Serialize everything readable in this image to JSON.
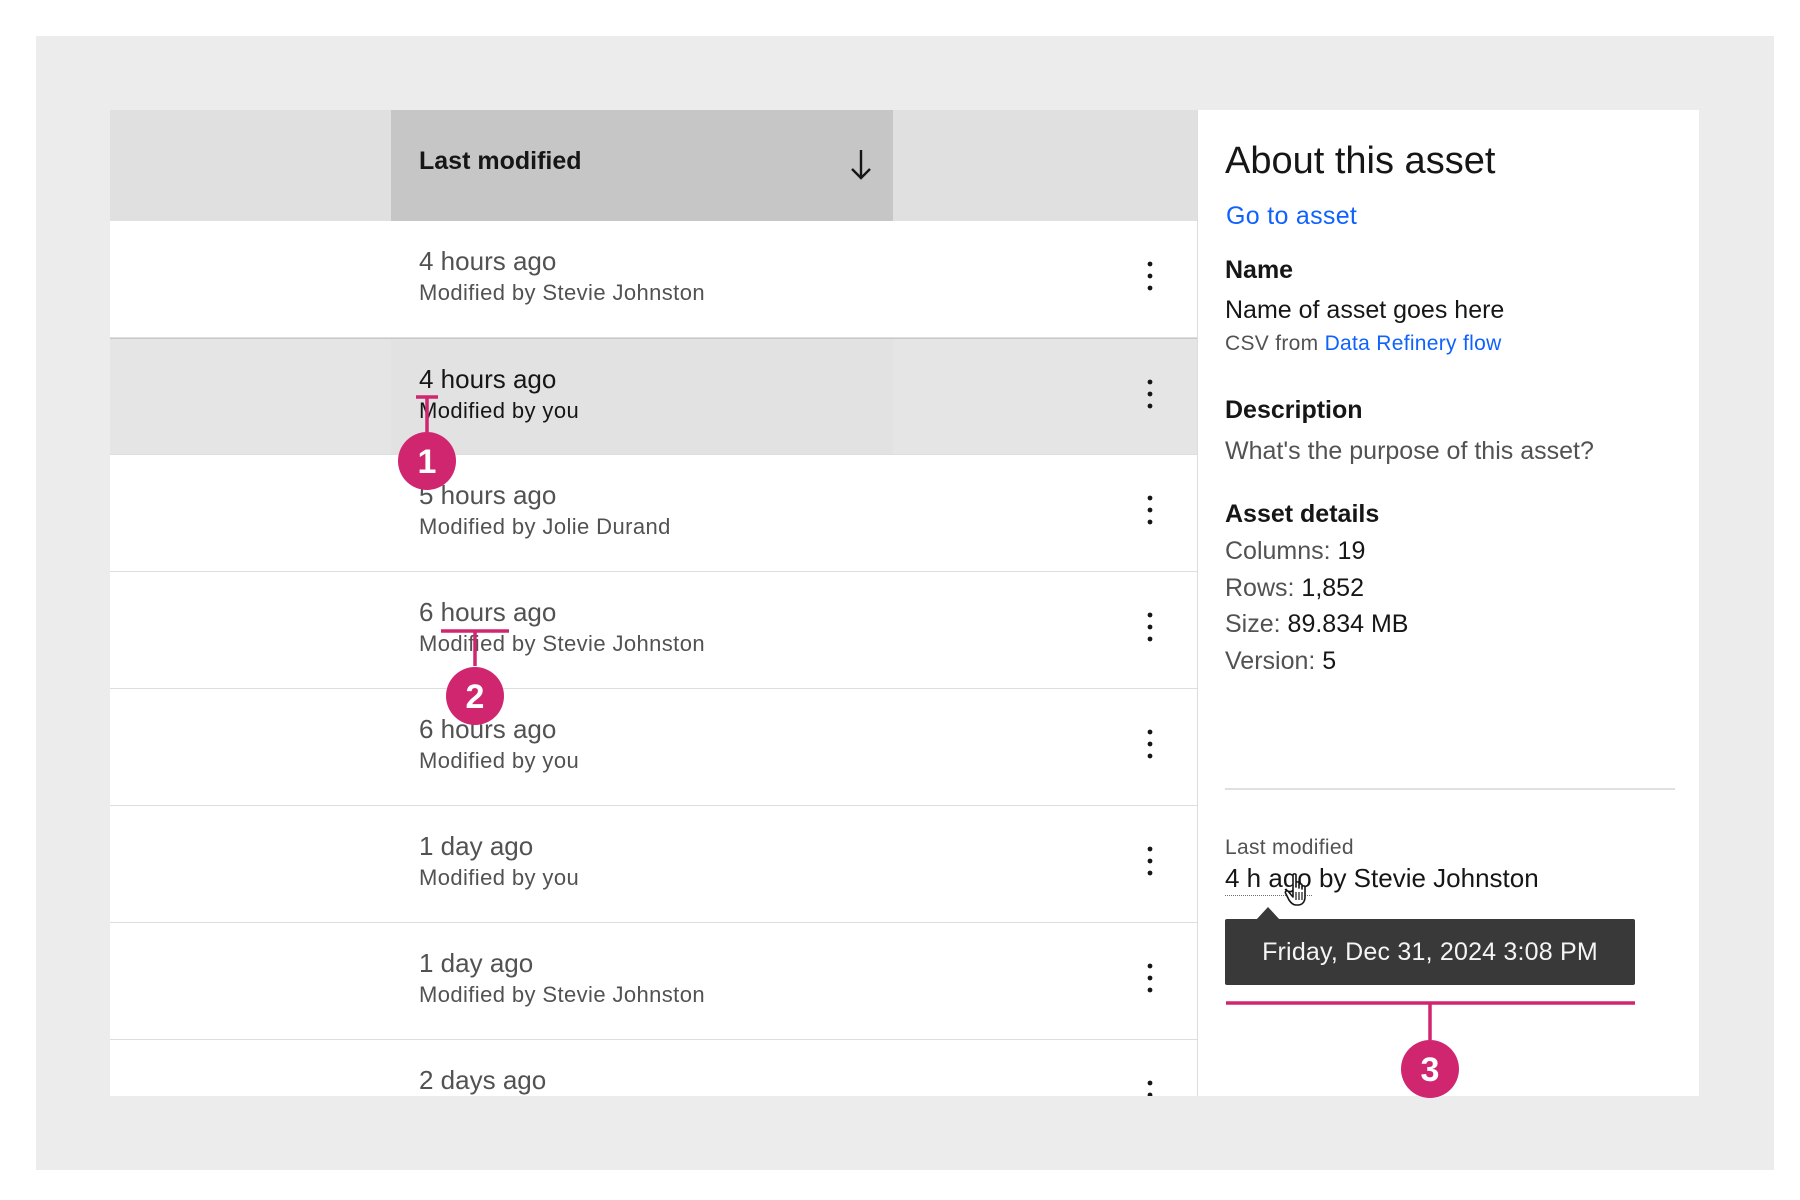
{
  "table": {
    "sorted_column": {
      "label": "Last modified",
      "sort_direction": "descending",
      "sort_icon": "arrow-down-icon"
    },
    "rows": [
      {
        "time": "4 hours ago",
        "by": "Modified by Stevie Johnston",
        "selected": false
      },
      {
        "time": "4 hours ago",
        "by": "Modified by you",
        "selected": true
      },
      {
        "time": "5 hours ago",
        "by": "Modified by Jolie Durand",
        "selected": false
      },
      {
        "time": "6 hours ago",
        "by": "Modified by Stevie Johnston",
        "selected": false
      },
      {
        "time": "6 hours ago",
        "by": "Modified by you",
        "selected": false
      },
      {
        "time": "1 day ago",
        "by": "Modified by you",
        "selected": false
      },
      {
        "time": "1 day ago",
        "by": "Modified by Stevie Johnston",
        "selected": false
      },
      {
        "time": "2 days ago",
        "by": "",
        "selected": false
      }
    ],
    "row_menu_icon": "overflow-menu-vertical-icon"
  },
  "panel": {
    "title": "About this asset",
    "go_to_asset": "Go to asset",
    "name_heading": "Name",
    "name_value": "Name of asset goes here",
    "source_prefix": "CSV from",
    "source_link": "Data Refinery flow",
    "description_heading": "Description",
    "description_placeholder": "What's the purpose of this asset?",
    "details_heading": "Asset details",
    "details": [
      {
        "label": "Columns:",
        "value": "19"
      },
      {
        "label": "Rows:",
        "value": "1,852"
      },
      {
        "label": "Size:",
        "value": "89.834 MB"
      },
      {
        "label": "Version:",
        "value": "5"
      }
    ],
    "last_modified_label": "Last modified",
    "last_modified_short": "4 h ago",
    "last_modified_by": "by Stevie Johnston",
    "tooltip": "Friday, Dec 31, 2024 3:08 PM"
  },
  "annotations": {
    "badges": [
      "1",
      "2",
      "3"
    ],
    "color": "#d02670"
  },
  "colors": {
    "link": "#0f62fe",
    "header_bg": "#e0e0e0",
    "sorted_header_bg": "#c6c6c6",
    "selected_row_bg": "#e5e5e5",
    "tooltip_bg": "#393939",
    "annotation": "#d02670"
  }
}
